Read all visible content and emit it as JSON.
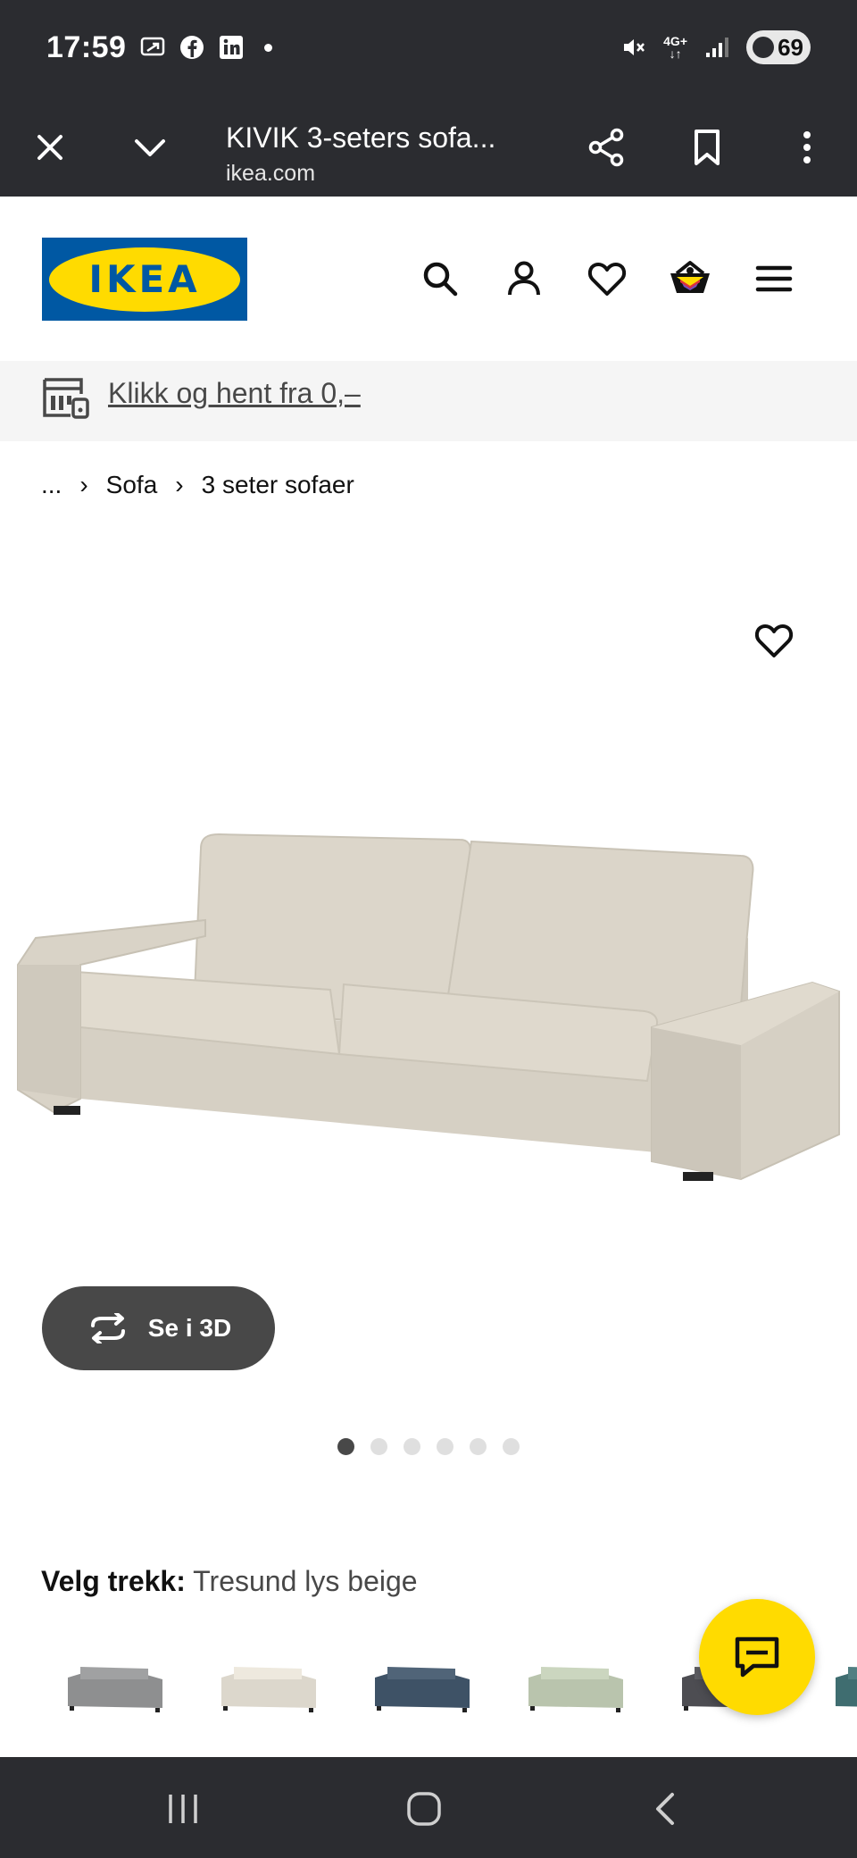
{
  "status_bar": {
    "time": "17:59",
    "network": "4G+",
    "battery": "69",
    "icons": [
      "cast-icon",
      "facebook-icon",
      "linkedin-icon",
      "mute-icon",
      "signal-icon"
    ]
  },
  "browser": {
    "page_title": "KIVIK 3-seters sofa...",
    "domain": "ikea.com",
    "icons": [
      "close-icon",
      "chevron-down-icon",
      "share-icon",
      "bookmark-icon",
      "more-icon"
    ]
  },
  "header": {
    "logo_text": "IKEA",
    "icons": [
      "search-icon",
      "account-icon",
      "wishlist-icon",
      "basket-icon",
      "menu-icon"
    ]
  },
  "promo": {
    "text": "Klikk og hent fra 0,–"
  },
  "breadcrumb": {
    "items": [
      "...",
      "Sofa",
      "3 seter sofaer"
    ],
    "separator": "›"
  },
  "gallery": {
    "see3d_label": "Se i 3D",
    "image_count": 6,
    "active_index": 0
  },
  "options": {
    "label": "Velg trekk:",
    "value": "Tresund lys beige",
    "swatches": [
      {
        "color": "#8e8f90"
      },
      {
        "color": "#dcd7cc"
      },
      {
        "color": "#3e5266"
      },
      {
        "color": "#b9c4ad"
      },
      {
        "color": "#4d4d52"
      },
      {
        "color": "#3f6d70"
      }
    ]
  },
  "colors": {
    "ikea_blue": "#0058a3",
    "ikea_yellow": "#ffdb00",
    "chrome": "#2b2c30",
    "sofa": "#dad4c8"
  }
}
